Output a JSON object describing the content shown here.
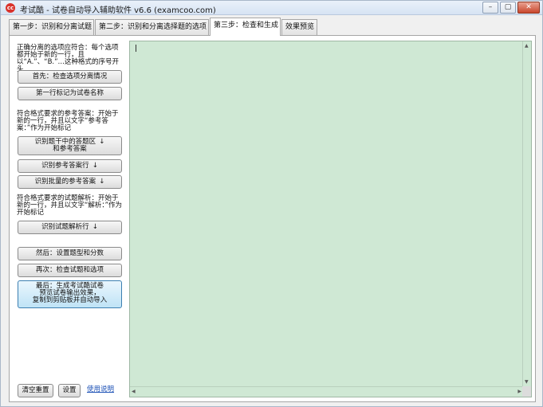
{
  "window": {
    "title": "考试酷 - 试卷自动导入辅助软件 v6.6 (examcoo.com)",
    "icon_name": "app-logo-icon",
    "icon_text": "cc",
    "controls": {
      "minimize": "–",
      "maximize": "▢",
      "close": "✕"
    }
  },
  "tabs": [
    {
      "label": "第一步：识别和分离试题"
    },
    {
      "label": "第二步：识别和分离选择题的选项"
    },
    {
      "label": "第三步：检查和生成",
      "active": true
    },
    {
      "label": "效果预览"
    }
  ],
  "left_panel": {
    "note_options": "正确分离的选项应符合：每个选项都开始于新的一行，且以“A.”、“B.”…这种格式的序号开头",
    "btn_check_options": "首先：检查选项分离情况",
    "btn_first_line_title": "第一行标记为试卷名称",
    "note_answers": "符合格式要求的参考答案：开始于新的一行，并且以文字“参考答案：”作为开始标记",
    "btn_identify_answer_area_line1": "识别题干中的答题区",
    "btn_identify_answer_area_line2": "和参考答案",
    "btn_identify_answer_line": "识别参考答案行",
    "btn_identify_batch_answers": "识别批量的参考答案",
    "note_analysis": "符合格式要求的试题解析：开始于新的一行，并且以文字“解析：”作为开始标记",
    "btn_identify_analysis": "识别试题解析行",
    "btn_set_type_score": "然后：设置题型和分数",
    "btn_check_questions": "再次：检查试题和选项",
    "btn_generate_line1": "最后：生成考试酷试卷",
    "btn_generate_line2": "预览试卷输出效果，",
    "btn_generate_line3": "复制到剪贴板并自动导入",
    "arrow": "↓",
    "btn_clear": "清空重置",
    "btn_settings": "设置",
    "help_link": "使用说明"
  },
  "editor": {
    "content": "",
    "background": "#cfe8d4"
  }
}
